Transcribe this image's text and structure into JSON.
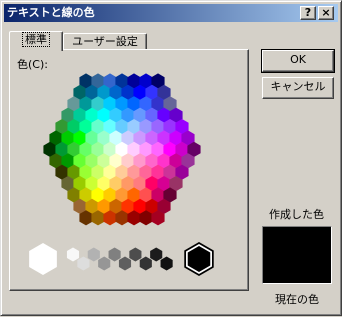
{
  "window": {
    "title": "テキストと線の色",
    "help_glyph": "?",
    "close_glyph": "×"
  },
  "tabs": [
    {
      "label": "標準",
      "active": true
    },
    {
      "label": "ユーザー設定",
      "active": false
    }
  ],
  "color_label": "色(C):",
  "buttons": {
    "ok": "OK",
    "cancel": "キャンセル"
  },
  "preview": {
    "new_label": "作成した色",
    "current_label": "現在の色",
    "swatch_color": "#000000"
  },
  "selected_color": "#000000",
  "palette": {
    "rows": [
      [
        "#003366",
        "#336699",
        "#3366cc",
        "#003399",
        "#000099",
        "#0000cc",
        "#000066"
      ],
      [
        "#006666",
        "#006699",
        "#0099cc",
        "#0066cc",
        "#0033cc",
        "#0000ff",
        "#3333ff",
        "#333399"
      ],
      [
        "#669999",
        "#009999",
        "#33cccc",
        "#00ccff",
        "#0099ff",
        "#0066ff",
        "#3366ff",
        "#3333cc",
        "#666699"
      ],
      [
        "#339966",
        "#00cc99",
        "#00ffcc",
        "#00ffff",
        "#33ccff",
        "#3399ff",
        "#6699ff",
        "#6666ff",
        "#6600ff",
        "#6600cc"
      ],
      [
        "#339933",
        "#00cc66",
        "#00ff99",
        "#66ffcc",
        "#66ffff",
        "#66ccff",
        "#99ccff",
        "#9999ff",
        "#9966ff",
        "#9933ff",
        "#9900ff"
      ],
      [
        "#006600",
        "#00cc00",
        "#00ff00",
        "#66ff99",
        "#99ffcc",
        "#ccffff",
        "#ccccff",
        "#cc99ff",
        "#cc66ff",
        "#cc33ff",
        "#cc00ff",
        "#9900cc"
      ],
      [
        "#003300",
        "#009933",
        "#33cc33",
        "#66ff66",
        "#99ff99",
        "#ccffcc",
        "#ffffff",
        "#ffccff",
        "#ff99ff",
        "#ff66ff",
        "#ff00ff",
        "#cc00cc",
        "#660066"
      ],
      [
        "#336600",
        "#009900",
        "#66ff33",
        "#99ff66",
        "#ccff99",
        "#ffffcc",
        "#ffcccc",
        "#ff99cc",
        "#ff66cc",
        "#ff33cc",
        "#cc0099",
        "#993399"
      ],
      [
        "#333300",
        "#669900",
        "#99ff33",
        "#ccff66",
        "#ffff99",
        "#ffcc99",
        "#ff9999",
        "#ff6699",
        "#ff3399",
        "#cc3399",
        "#990099"
      ],
      [
        "#666633",
        "#99cc00",
        "#ccff33",
        "#ffff66",
        "#ffcc66",
        "#ff9966",
        "#ff7c80",
        "#ff0066",
        "#d60093",
        "#993366"
      ],
      [
        "#808000",
        "#cccc00",
        "#ffff00",
        "#ffcc00",
        "#ff9933",
        "#ff6600",
        "#ff5050",
        "#cc0066",
        "#660033"
      ],
      [
        "#996633",
        "#cc9900",
        "#ff9900",
        "#cc6600",
        "#ff3300",
        "#ff0000",
        "#cc0000",
        "#990033"
      ],
      [
        "#663300",
        "#996600",
        "#cc3300",
        "#993300",
        "#990000",
        "#800000",
        "#a50021"
      ]
    ],
    "grays": [
      "#ffffff",
      "#f8f8f8",
      "#dddddd",
      "#b2b2b2",
      "#969696",
      "#808080",
      "#5f5f5f",
      "#4d4d4d",
      "#333333",
      "#1c1c1c",
      "#111111",
      "#000000"
    ]
  }
}
